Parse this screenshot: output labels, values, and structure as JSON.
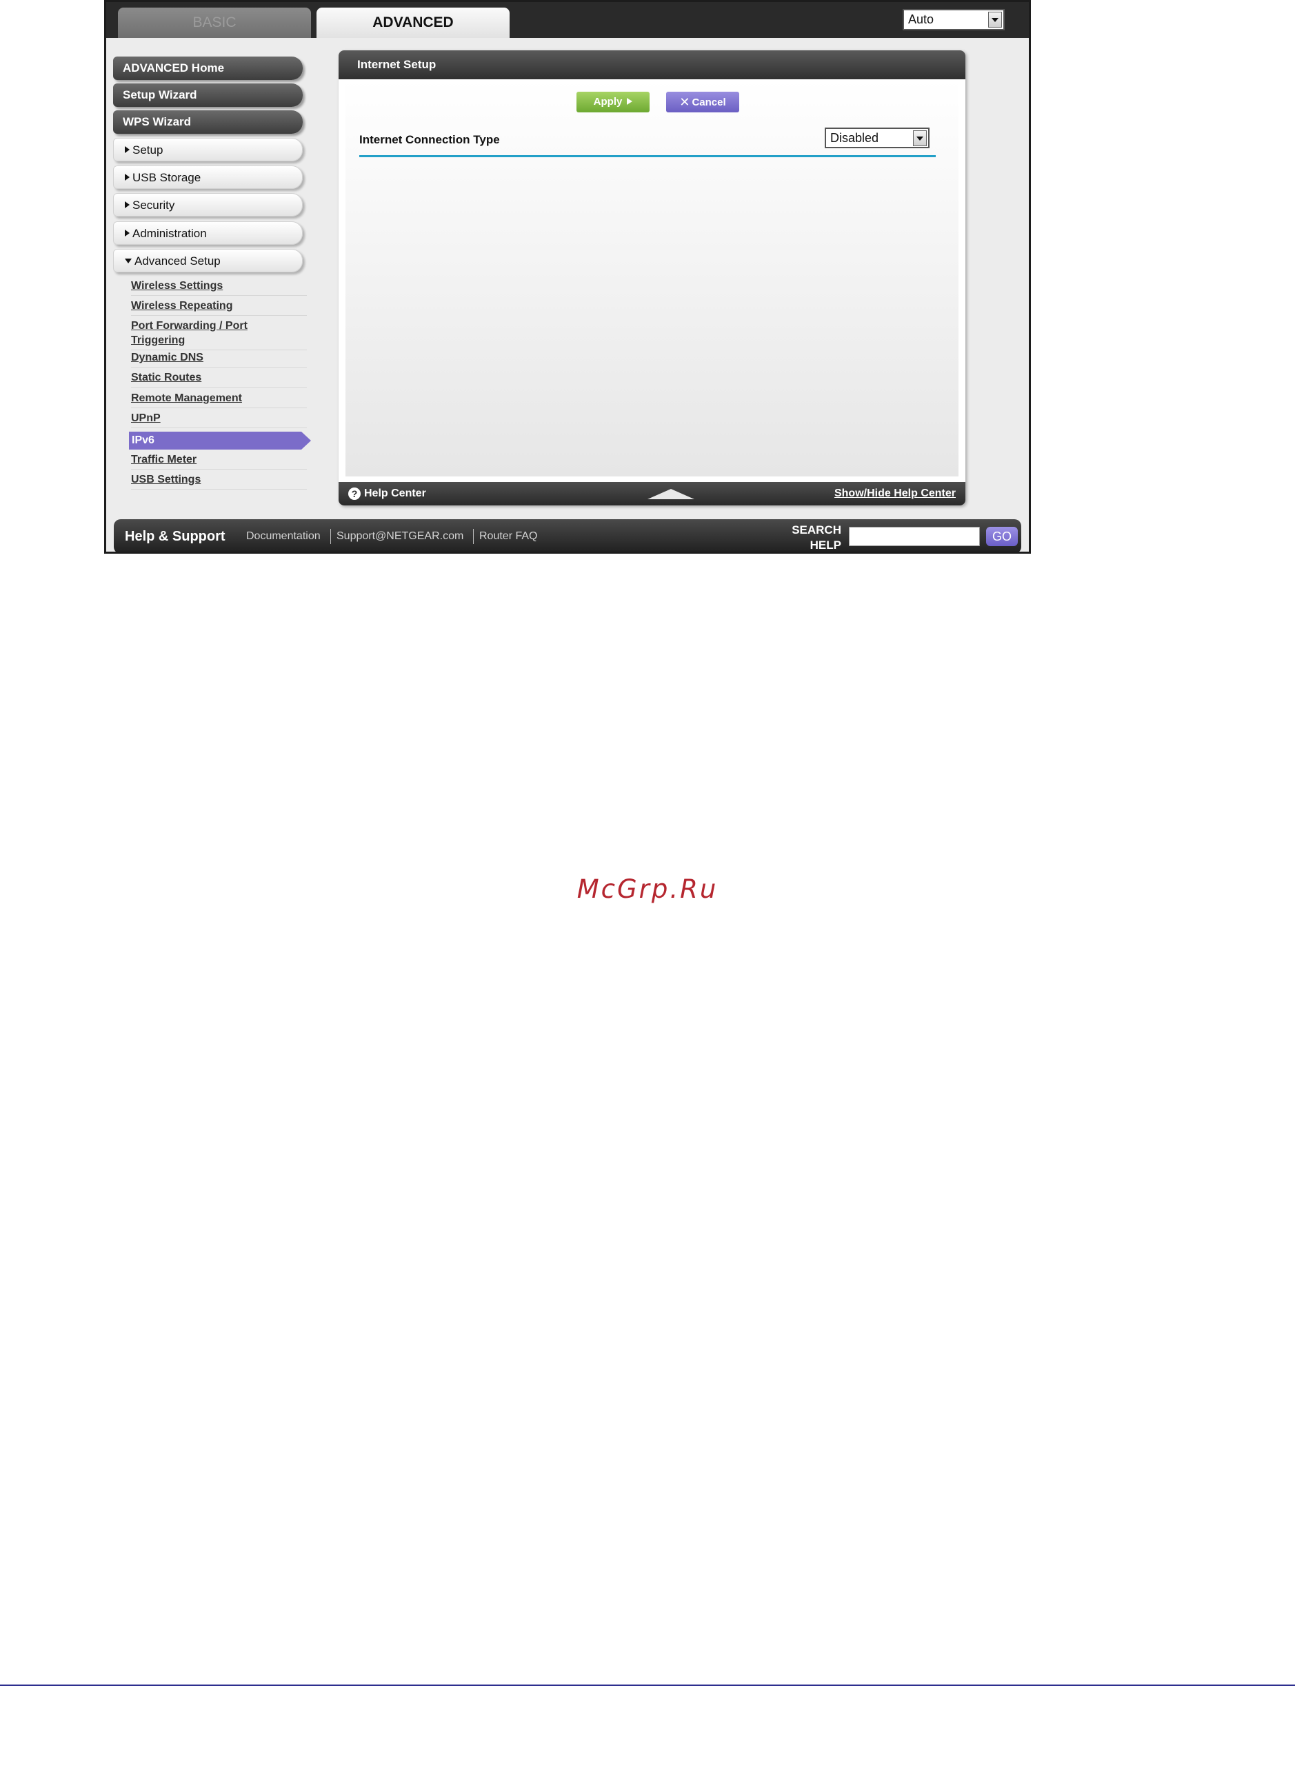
{
  "topbar": {
    "tabs": [
      {
        "label": "BASIC",
        "active": false
      },
      {
        "label": "ADVANCED",
        "active": true
      }
    ],
    "language_select": {
      "value": "Auto"
    }
  },
  "sidebar": {
    "primary": [
      "ADVANCED Home",
      "Setup Wizard",
      "WPS Wizard"
    ],
    "sections": [
      {
        "label": "Setup",
        "expanded": false
      },
      {
        "label": "USB Storage",
        "expanded": false
      },
      {
        "label": "Security",
        "expanded": false
      },
      {
        "label": "Administration",
        "expanded": false
      },
      {
        "label": "Advanced Setup",
        "expanded": true
      }
    ],
    "sub_items": [
      "Wireless Settings",
      "Wireless Repeating",
      "Port Forwarding / Port",
      "Triggering",
      "Dynamic DNS",
      "Static Routes",
      "Remote Management",
      "UPnP",
      "IPv6",
      "Traffic Meter",
      "USB Settings"
    ],
    "selected_item": "IPv6"
  },
  "panel": {
    "title": "Internet Setup",
    "apply_label": "Apply",
    "cancel_label": "Cancel",
    "connection_type_label": "Internet Connection Type",
    "connection_type_value": "Disabled",
    "footer": {
      "help_center": "Help Center",
      "show_hide": "Show/Hide Help Center"
    }
  },
  "helpbar": {
    "title": "Help & Support",
    "links": [
      "Documentation",
      "Support@NETGEAR.com",
      "Router FAQ"
    ],
    "search_label_line1": "SEARCH",
    "search_label_line2": "HELP",
    "go_label": "GO"
  },
  "watermark": "McGrp.Ru",
  "colors": {
    "accent_purple": "#7b6cc9",
    "apply_green": "#7fbb3c",
    "divider_blue": "#23a0c8",
    "watermark_red": "#b5262f"
  }
}
